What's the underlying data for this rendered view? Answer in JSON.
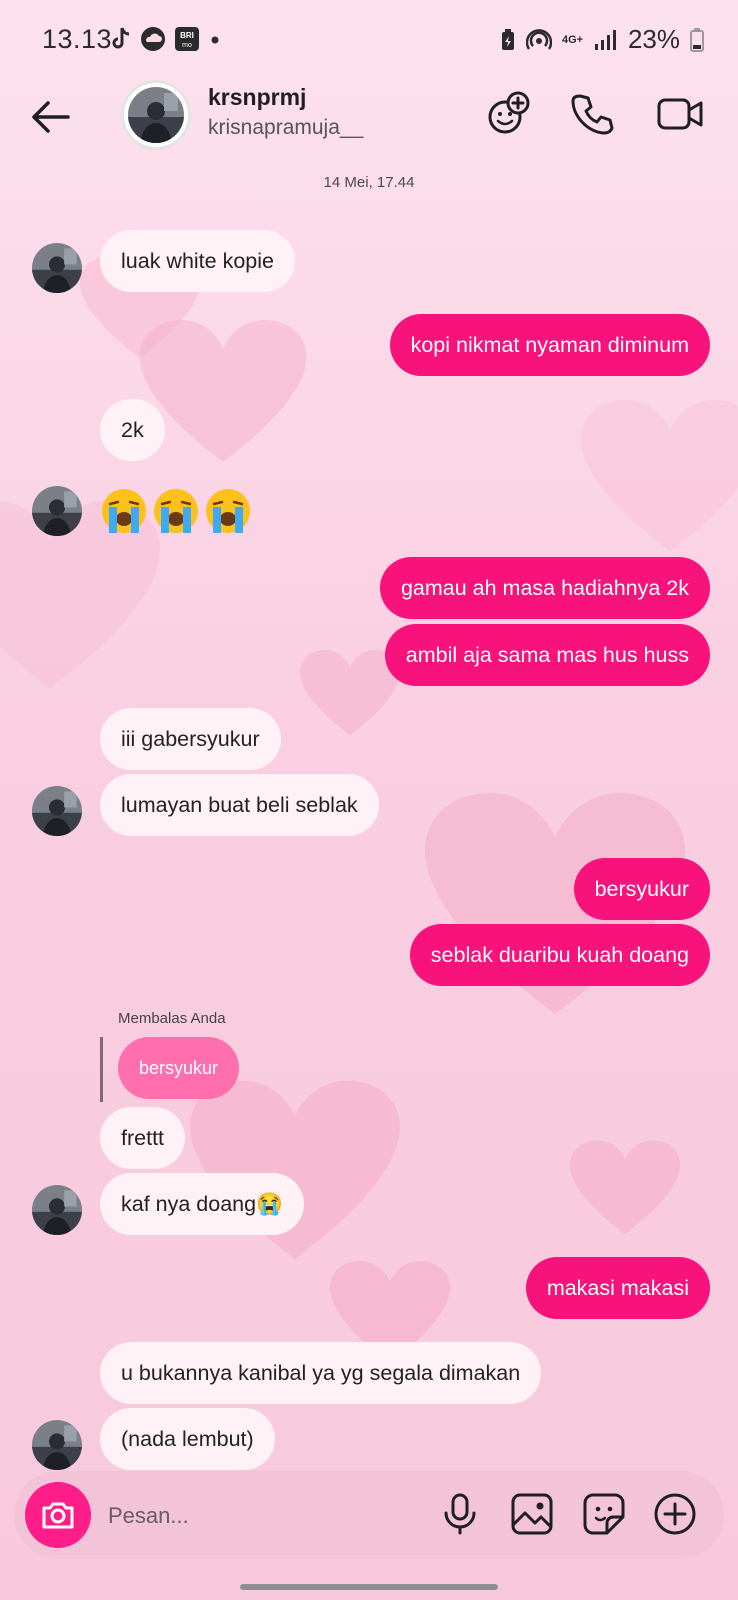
{
  "status_bar": {
    "time": "13.13",
    "network": "4G+",
    "battery": "23%",
    "left_icons": [
      "tiktok-icon",
      "cloud-app-icon",
      "brimo-icon",
      "dot-icon"
    ],
    "right_icons": [
      "battery-saver-icon",
      "hotspot-icon",
      "signal-icon",
      "battery-icon"
    ]
  },
  "header": {
    "name": "krsnprmj",
    "username": "krisnapramuja__",
    "icons": [
      "back-arrow-icon",
      "add-friend-icon",
      "phone-icon",
      "video-icon"
    ]
  },
  "chat": {
    "timestamp": "14 Mei, 17.44",
    "messages": [
      {
        "dir": "in",
        "text": "luak white kopie"
      },
      {
        "dir": "out",
        "text": "kopi nikmat nyaman diminum"
      },
      {
        "dir": "in",
        "text": "2k"
      },
      {
        "dir": "in",
        "text": "😭😭😭",
        "emoji_only": true
      },
      {
        "dir": "out",
        "text": "gamau ah masa hadiahnya 2k"
      },
      {
        "dir": "out",
        "text": "ambil aja sama mas hus huss"
      },
      {
        "dir": "in",
        "text": "iii gabersyukur"
      },
      {
        "dir": "in",
        "text": "lumayan buat beli seblak"
      },
      {
        "dir": "out",
        "text": "bersyukur"
      },
      {
        "dir": "out",
        "text": "seblak duaribu kuah doang"
      },
      {
        "dir": "in",
        "text": "frettt"
      },
      {
        "dir": "in",
        "text": "kaf nya doang😭"
      },
      {
        "dir": "out",
        "text": "makasi makasi"
      },
      {
        "dir": "in",
        "text": "u bukannya kanibal ya yg segala dimakan"
      },
      {
        "dir": "in",
        "text": "(nada lembut)"
      }
    ],
    "reply": {
      "label": "Membalas Anda",
      "quoted": "bersyukur"
    }
  },
  "composer": {
    "placeholder": "Pesan...",
    "icons": [
      "camera-icon",
      "microphone-icon",
      "gallery-icon",
      "sticker-icon",
      "plus-icon"
    ]
  },
  "colors": {
    "outgoing_bubble": "#f7127c",
    "incoming_bubble": "#fff2f6",
    "reply_quote": "#ff6fad",
    "camera_button": "#ff1d89",
    "composer": "#f3c3d8"
  }
}
